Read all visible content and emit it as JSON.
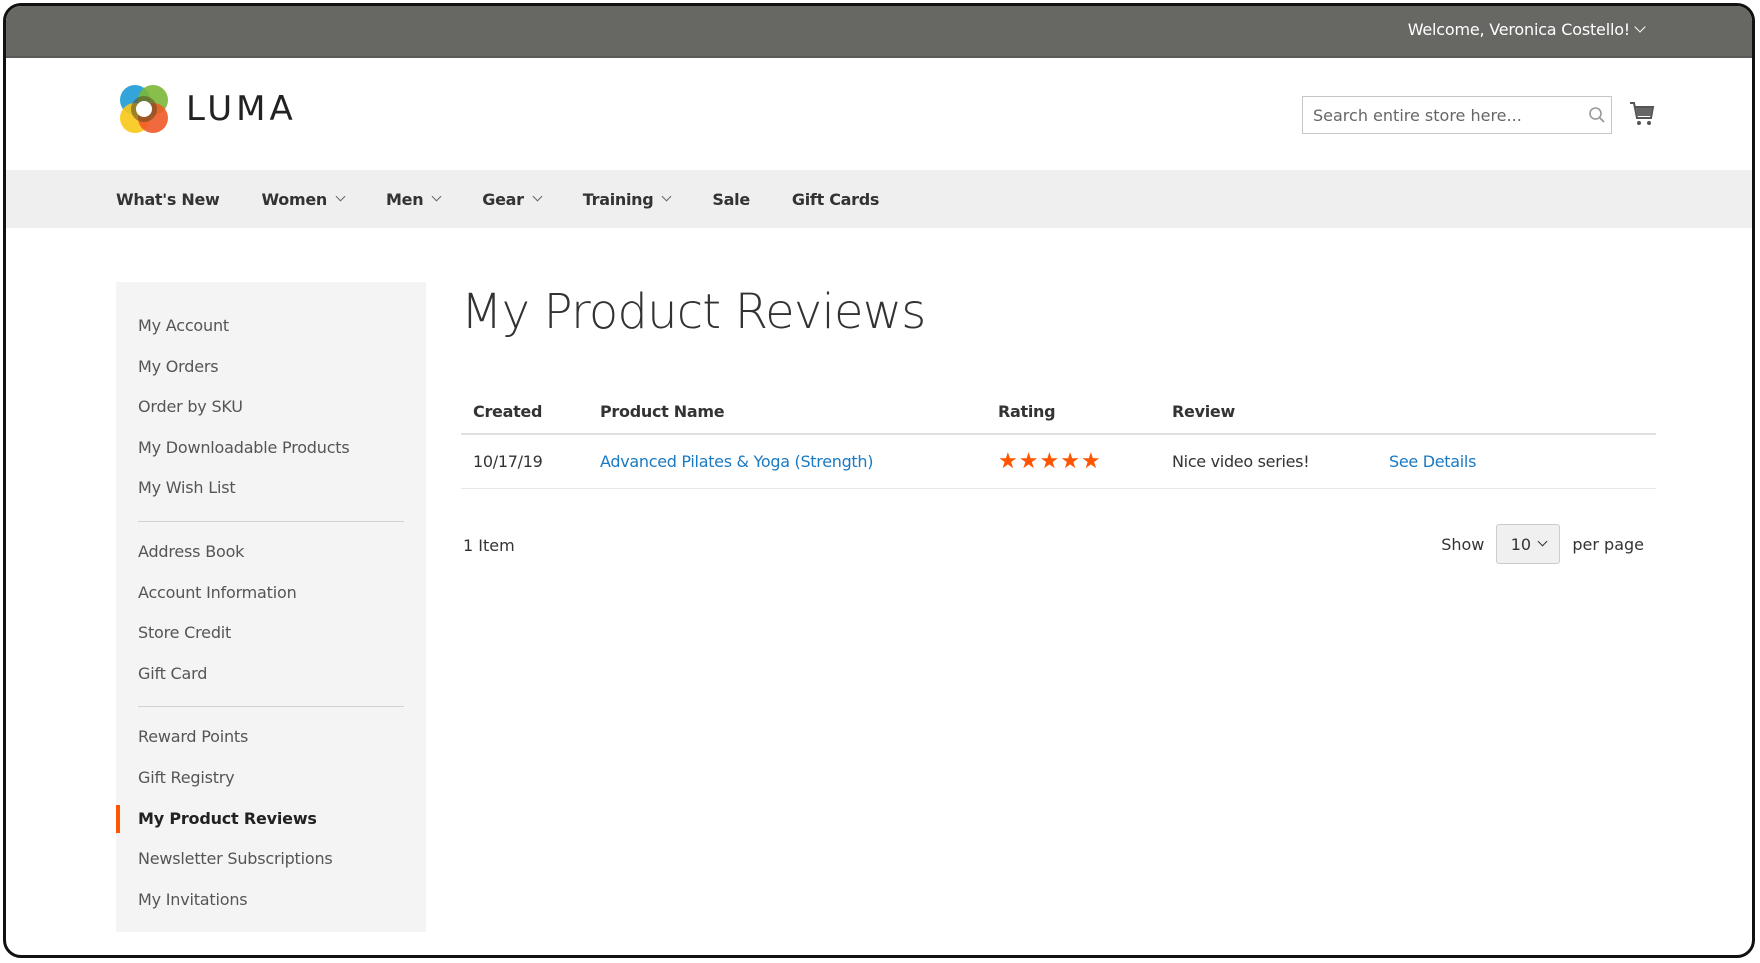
{
  "header": {
    "welcome": "Welcome, Veronica Costello!",
    "logo_text": "LUMA",
    "search_placeholder": "Search entire store here..."
  },
  "nav": [
    {
      "label": "What's New",
      "dropdown": false
    },
    {
      "label": "Women",
      "dropdown": true
    },
    {
      "label": "Men",
      "dropdown": true
    },
    {
      "label": "Gear",
      "dropdown": true
    },
    {
      "label": "Training",
      "dropdown": true
    },
    {
      "label": "Sale",
      "dropdown": false
    },
    {
      "label": "Gift Cards",
      "dropdown": false
    }
  ],
  "sidebar": {
    "groups": [
      [
        "My Account",
        "My Orders",
        "Order by SKU",
        "My Downloadable Products",
        "My Wish List"
      ],
      [
        "Address Book",
        "Account Information",
        "Store Credit",
        "Gift Card"
      ],
      [
        "Reward Points",
        "Gift Registry",
        "My Product Reviews",
        "Newsletter Subscriptions",
        "My Invitations"
      ]
    ],
    "active": "My Product Reviews"
  },
  "main": {
    "title": "My Product Reviews",
    "columns": [
      "Created",
      "Product Name",
      "Rating",
      "Review",
      ""
    ],
    "rows": [
      {
        "created": "10/17/19",
        "product": "Advanced Pilates & Yoga (Strength)",
        "rating": 5,
        "rating_max": 5,
        "review": "Nice video series!",
        "action": "See Details"
      }
    ],
    "item_count": "1 Item",
    "show_label": "Show",
    "per_page_value": "10",
    "per_page_label": "per page"
  },
  "colors": {
    "accent": "#ff5501",
    "link": "#1979c3",
    "topbar": "#676864"
  }
}
